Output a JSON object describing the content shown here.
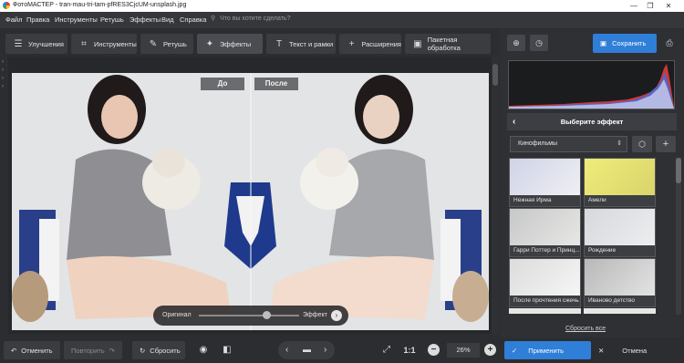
{
  "window": {
    "title": "ФотоМАСТЕР - tran-mau-tri-tam-pfRES3CjcUM-unsplash.jpg"
  },
  "menu": {
    "items": [
      "Файл",
      "Правка",
      "Инструменты",
      "Ретушь",
      "Эффекты",
      "Вид",
      "Справка"
    ],
    "search_placeholder": "Что вы хотите сделать?"
  },
  "tabs": [
    {
      "label": "Улучшения",
      "icon": "sliders-icon"
    },
    {
      "label": "Инструменты",
      "icon": "crop-icon"
    },
    {
      "label": "Ретушь",
      "icon": "brush-icon"
    },
    {
      "label": "Эффекты",
      "icon": "sparkle-icon",
      "active": true
    },
    {
      "label": "Текст и рамки",
      "icon": "text-icon"
    },
    {
      "label": "Расширения",
      "icon": "plus-icon"
    },
    {
      "label": "Пакетная обработка",
      "icon": "batch-icon"
    }
  ],
  "compare": {
    "before": "До",
    "after": "После",
    "original": "Оригинал",
    "effect": "Эффект"
  },
  "toolbar": {
    "save": "Сохранить"
  },
  "effects_panel": {
    "title": "Выберите эффект",
    "category": "Кинофильмы",
    "reset_all": "Сбросить все",
    "items": [
      {
        "label": "Нежная Ирма"
      },
      {
        "label": "Амели"
      },
      {
        "label": "Гарри Поттер и Принц..."
      },
      {
        "label": "Рождение"
      },
      {
        "label": "После прочтения сжечь"
      },
      {
        "label": "Иваново детство"
      }
    ]
  },
  "bottom": {
    "undo": "Отменить",
    "redo": "Повторить",
    "reset": "Сбросить",
    "ratio": "1:1",
    "zoom": "26%",
    "apply": "Применить",
    "cancel": "Отмена"
  },
  "colors": {
    "accent": "#2f7ed8",
    "panel": "#2e3034",
    "background": "#2b2d30"
  }
}
